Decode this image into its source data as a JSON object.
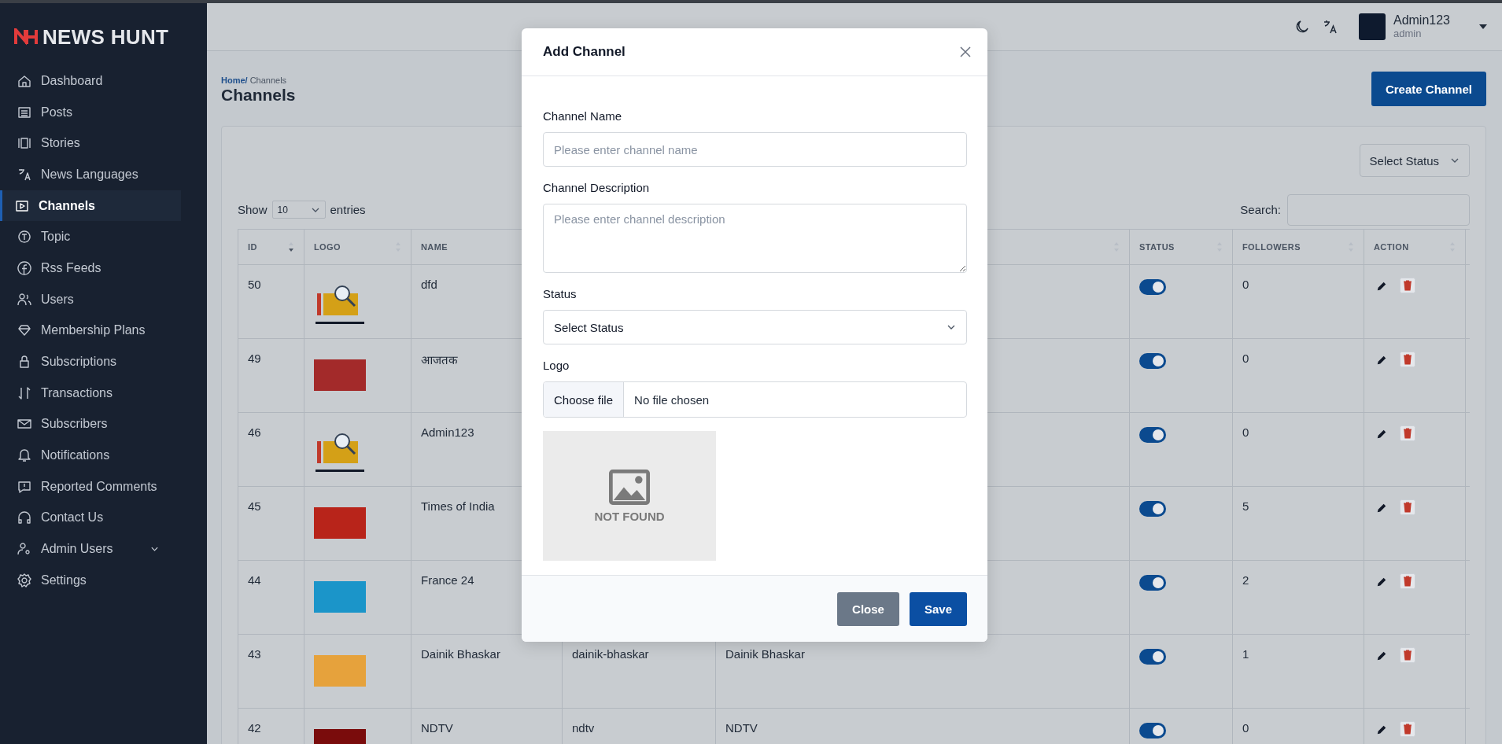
{
  "brand": {
    "name": "NEWS HUNT"
  },
  "sidebar": {
    "items": [
      {
        "label": "Dashboard",
        "selected": false
      },
      {
        "label": "Posts",
        "selected": false
      },
      {
        "label": "Stories",
        "selected": false
      },
      {
        "label": "News Languages",
        "selected": false
      },
      {
        "label": "Channels",
        "selected": true
      },
      {
        "label": "Topic",
        "selected": false
      },
      {
        "label": "Rss Feeds",
        "selected": false
      },
      {
        "label": "Users",
        "selected": false
      },
      {
        "label": "Membership Plans",
        "selected": false
      },
      {
        "label": "Subscriptions",
        "selected": false
      },
      {
        "label": "Transactions",
        "selected": false
      },
      {
        "label": "Subscribers",
        "selected": false
      },
      {
        "label": "Notifications",
        "selected": false
      },
      {
        "label": "Reported Comments",
        "selected": false
      },
      {
        "label": "Contact Us",
        "selected": false
      },
      {
        "label": "Admin Users",
        "selected": false,
        "expandable": true
      },
      {
        "label": "Settings",
        "selected": false
      }
    ]
  },
  "user": {
    "name": "Admin123",
    "role": "admin"
  },
  "breadcrumb": {
    "home": "Home/",
    "current": "Channels"
  },
  "page_title": "Channels",
  "create_button": "Create Channel",
  "status_filter": "Select Status",
  "entries": {
    "show": "Show",
    "value": "10",
    "suffix": "entries"
  },
  "search": {
    "label": "Search:"
  },
  "table": {
    "columns": [
      {
        "label": "ID",
        "sorted": true
      },
      {
        "label": "LOGO",
        "sorted": false
      },
      {
        "label": "NAME"
      },
      {},
      {
        "sorted": false
      },
      {
        "label": "STATUS",
        "sorted": false
      },
      {
        "label": "FOLLOWERS",
        "sorted": false
      },
      {
        "label": "ACTION",
        "sorted": false
      }
    ],
    "rows": [
      {
        "id": "50",
        "logo": {
          "kind": "not-found"
        },
        "name": "dfd",
        "on": true,
        "followers": "0"
      },
      {
        "id": "49",
        "logo": {
          "kind": "block",
          "color": "#a32a2a"
        },
        "name": "आजतक",
        "on": true,
        "followers": "0"
      },
      {
        "id": "46",
        "logo": {
          "kind": "not-found"
        },
        "name": "Admin123",
        "on": true,
        "followers": "0"
      },
      {
        "id": "45",
        "logo": {
          "kind": "block",
          "color": "#b8241a"
        },
        "name": "Times of India",
        "on": true,
        "followers": "5"
      },
      {
        "id": "44",
        "logo": {
          "kind": "block",
          "color": "#1b95c9"
        },
        "name": "France 24",
        "on": true,
        "followers": "2"
      },
      {
        "id": "43",
        "logo": {
          "kind": "block",
          "color": "#e6a23c"
        },
        "name": "Dainik Bhaskar",
        "column_4": "dainik-bhaskar",
        "column_5": "Dainik Bhaskar",
        "on": true,
        "followers": "1"
      },
      {
        "id": "42",
        "logo": {
          "kind": "block",
          "color": "#7a0c0c"
        },
        "name": "NDTV",
        "column_4": "ndtv",
        "column_5": "NDTV",
        "on": true,
        "followers": "0"
      }
    ]
  },
  "modal": {
    "title": "Add Channel",
    "name_label": "Channel Name",
    "name_placeholder": "Please enter channel name",
    "description_label": "Channel Description",
    "description_placeholder": "Please enter channel description",
    "status_label": "Status",
    "status_value": "Select Status",
    "logo_label": "Logo",
    "file_button": "Choose file",
    "file_status": "No file chosen",
    "preview_text": "NOT FOUND",
    "buttons": [
      {
        "label": "Close",
        "kind": "secondary"
      },
      {
        "label": "Save",
        "kind": "primary"
      }
    ]
  }
}
